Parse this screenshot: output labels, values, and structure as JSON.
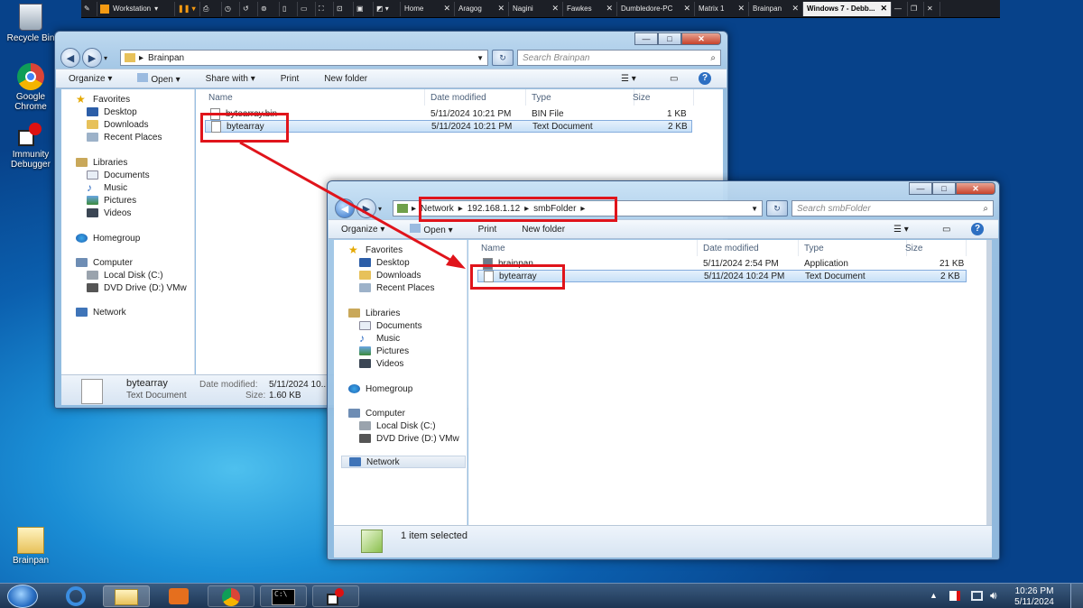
{
  "vmware": {
    "workstation_label": "Workstation",
    "tabs": [
      "Home",
      "Aragog",
      "Nagini",
      "Fawkes",
      "Dumbledore-PC",
      "Matrix 1",
      "Brainpan"
    ],
    "active_tab": "Windows 7 - Debb..."
  },
  "desktop": {
    "icons": [
      "Recycle Bin",
      "Google Chrome",
      "Immunity Debugger",
      "Brainpan"
    ]
  },
  "window1": {
    "address": "Brainpan",
    "search_placeholder": "Search Brainpan",
    "toolbar": {
      "organize": "Organize",
      "open": "Open",
      "share": "Share with",
      "print": "Print",
      "new_folder": "New folder"
    },
    "nav": {
      "favorites": "Favorites",
      "desktop": "Desktop",
      "downloads": "Downloads",
      "recent": "Recent Places",
      "libraries": "Libraries",
      "documents": "Documents",
      "music": "Music",
      "pictures": "Pictures",
      "videos": "Videos",
      "homegroup": "Homegroup",
      "computer": "Computer",
      "local_disk": "Local Disk (C:)",
      "dvd": "DVD Drive (D:) VMw",
      "network": "Network"
    },
    "columns": {
      "name": "Name",
      "date": "Date modified",
      "type": "Type",
      "size": "Size"
    },
    "files": [
      {
        "name": "bytearray.bin",
        "date": "5/11/2024 10:21 PM",
        "type": "BIN File",
        "size": "1 KB"
      },
      {
        "name": "bytearray",
        "date": "5/11/2024 10:21 PM",
        "type": "Text Document",
        "size": "2 KB"
      }
    ],
    "details": {
      "name": "bytearray",
      "kind": "Text Document",
      "date_label": "Date modified:",
      "date_value": "5/11/2024 10...",
      "size_label": "Size:",
      "size_value": "1.60 KB"
    }
  },
  "window2": {
    "breadcrumb": [
      "Network",
      "192.168.1.12",
      "smbFolder"
    ],
    "search_placeholder": "Search smbFolder",
    "toolbar": {
      "organize": "Organize",
      "open": "Open",
      "print": "Print",
      "new_folder": "New folder"
    },
    "nav": {
      "favorites": "Favorites",
      "desktop": "Desktop",
      "downloads": "Downloads",
      "recent": "Recent Places",
      "libraries": "Libraries",
      "documents": "Documents",
      "music": "Music",
      "pictures": "Pictures",
      "videos": "Videos",
      "homegroup": "Homegroup",
      "computer": "Computer",
      "local_disk": "Local Disk (C:)",
      "dvd": "DVD Drive (D:) VMw",
      "network": "Network"
    },
    "columns": {
      "name": "Name",
      "date": "Date modified",
      "type": "Type",
      "size": "Size"
    },
    "files": [
      {
        "name": "brainpan",
        "date": "5/11/2024 2:54 PM",
        "type": "Application",
        "size": "21 KB"
      },
      {
        "name": "bytearray",
        "date": "5/11/2024 10:24 PM",
        "type": "Text Document",
        "size": "2 KB"
      }
    ],
    "status": "1 item selected"
  },
  "tray": {
    "time": "10:26 PM",
    "date": "5/11/2024"
  },
  "colors": {
    "highlight": "#e0141b",
    "selection": "#c7e0f7"
  }
}
